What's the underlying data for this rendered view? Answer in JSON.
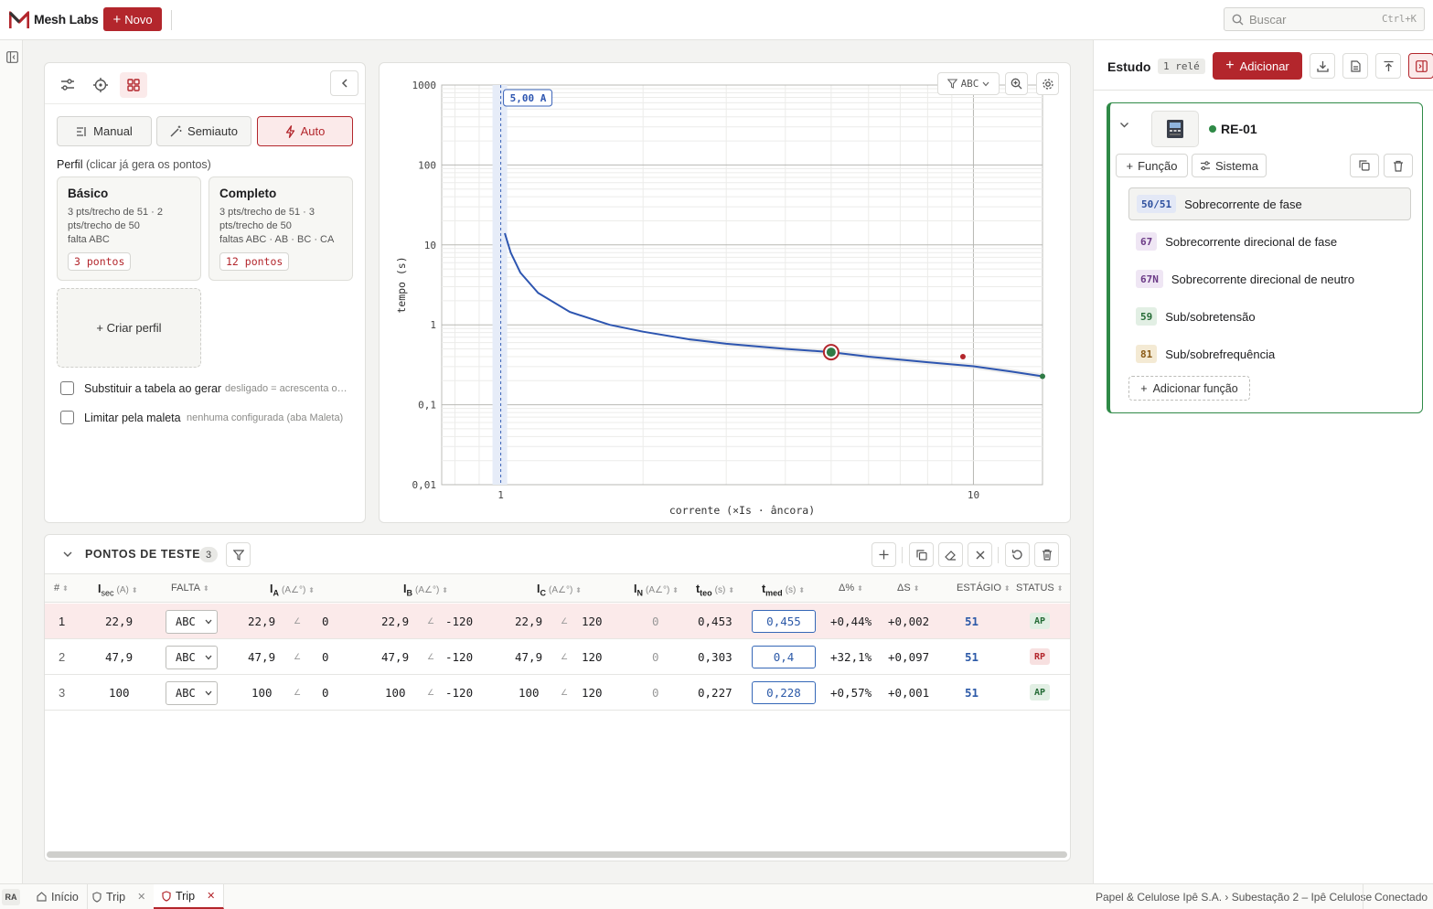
{
  "header": {
    "app_name": "Mesh Labs",
    "new_label": "Novo",
    "search_placeholder": "Buscar",
    "search_shortcut": "Ctrl+K",
    "brand_color": "#b3262c"
  },
  "left_panel": {
    "modes": [
      {
        "label": "Manual",
        "active": false
      },
      {
        "label": "Semiauto",
        "active": false
      },
      {
        "label": "Auto",
        "active": true
      }
    ],
    "profile_title": "Perfil",
    "profile_hint": "(clicar já gera os pontos)",
    "profiles": [
      {
        "name": "Básico",
        "line1": "3 pts/trecho de 51 · 2",
        "line2": "pts/trecho de 50",
        "line3": "falta ABC",
        "badge": "3 pontos"
      },
      {
        "name": "Completo",
        "line1": "3 pts/trecho de 51 · 3",
        "line2": "pts/trecho de 50",
        "line3": "faltas ABC · AB · BC · CA",
        "badge": "12 pontos"
      }
    ],
    "create_profile": "+ Criar perfil",
    "options": [
      {
        "label": "Substituir a tabela ao gerar",
        "hint": "desligado = acrescenta os ...",
        "checked": false
      },
      {
        "label": "Limitar pela maleta",
        "hint": "nenhuma configurada (aba Maleta)",
        "checked": false
      }
    ]
  },
  "chart_toolbar": {
    "fault_filter": "ABC"
  },
  "chart_data": {
    "type": "line",
    "xscale": "log",
    "yscale": "log",
    "xlim": [
      0.75,
      14
    ],
    "ylim": [
      0.01,
      1000
    ],
    "xlabel": "corrente (×Is · âncora)",
    "ylabel": "tempo (s)",
    "x_ticks": [
      "1",
      "10"
    ],
    "y_ticks": [
      "0,01",
      "0,1",
      "1",
      "10",
      "100",
      "1000"
    ],
    "marker_label": "5,00 A",
    "marker_x": 1.0,
    "grid": true,
    "curve": {
      "x": [
        1.02,
        1.05,
        1.1,
        1.2,
        1.4,
        1.7,
        2.0,
        2.5,
        3.0,
        4.0,
        5.0,
        6.0,
        8.0,
        10.0,
        12.0,
        14.0
      ],
      "y": [
        14.0,
        8.0,
        4.5,
        2.5,
        1.45,
        1.0,
        0.82,
        0.66,
        0.58,
        0.5,
        0.455,
        0.4,
        0.34,
        0.303,
        0.26,
        0.227
      ]
    },
    "points": [
      {
        "x": 5.0,
        "y": 0.455,
        "status": "AP",
        "selected": true
      },
      {
        "x": 9.5,
        "y": 0.4,
        "status": "RP"
      },
      {
        "x": 14.0,
        "y": 0.227,
        "status": "AP"
      }
    ],
    "curve_color": "#2d55b0"
  },
  "table": {
    "title": "PONTOS DE TESTE",
    "count": "3",
    "columns": {
      "num": "#",
      "isec": "I",
      "isec_sub": "sec",
      "isec_unit": "(A)",
      "falta": "FALTA",
      "ia": "I",
      "ia_sub": "A",
      "ia_unit": "(A∠°)",
      "ib": "I",
      "ib_sub": "B",
      "ib_unit": "(A∠°)",
      "ic": "I",
      "ic_sub": "C",
      "ic_unit": "(A∠°)",
      "in": "I",
      "in_sub": "N",
      "in_unit": "(A∠°)",
      "tteo": "t",
      "tteo_sub": "teo",
      "tteo_unit": "(s)",
      "tmed": "t",
      "tmed_sub": "med",
      "tmed_unit": "(s)",
      "dpct": "Δ%",
      "ds": "ΔS",
      "estagio": "ESTÁGIO",
      "status": "STATUS"
    },
    "angle_symbol": "∠",
    "rows": [
      {
        "num": "1",
        "isec": "22,9",
        "falta": "ABC",
        "ia": "22,9",
        "ia_ang": "0",
        "ib": "22,9",
        "ib_ang": "-120",
        "ic": "22,9",
        "ic_ang": "120",
        "in": "0",
        "tteo": "0,453",
        "tmed": "0,455",
        "dpct": "+0,44%",
        "ds": "+0,002",
        "estagio": "51",
        "status": "AP"
      },
      {
        "num": "2",
        "isec": "47,9",
        "falta": "ABC",
        "ia": "47,9",
        "ia_ang": "0",
        "ib": "47,9",
        "ib_ang": "-120",
        "ic": "47,9",
        "ic_ang": "120",
        "in": "0",
        "tteo": "0,303",
        "tmed": "0,4",
        "dpct": "+32,1%",
        "ds": "+0,097",
        "estagio": "51",
        "status": "RP"
      },
      {
        "num": "3",
        "isec": "100",
        "falta": "ABC",
        "ia": "100",
        "ia_ang": "0",
        "ib": "100",
        "ib_ang": "-120",
        "ic": "100",
        "ic_ang": "120",
        "in": "0",
        "tteo": "0,227",
        "tmed": "0,228",
        "dpct": "+0,57%",
        "ds": "+0,001",
        "estagio": "51",
        "status": "AP"
      }
    ]
  },
  "right_panel": {
    "title": "Estudo",
    "count_badge": "1 relé",
    "add_label": "Adicionar",
    "relay": {
      "name": "RE-01",
      "funcao_label": "Função",
      "sistema_label": "Sistema",
      "functions": [
        {
          "code": "50/51",
          "name": "Sobrecorrente de fase",
          "selected": true,
          "bg": "#e3e8f6",
          "fg": "#2d4f9e"
        },
        {
          "code": "67",
          "name": "Sobrecorrente direcional de fase",
          "bg": "#efe6f4",
          "fg": "#6b3a86"
        },
        {
          "code": "67N",
          "name": "Sobrecorrente direcional de neutro",
          "bg": "#efe6f4",
          "fg": "#6b3a86"
        },
        {
          "code": "59",
          "name": "Sub/sobretensão",
          "bg": "#e2efe4",
          "fg": "#256b36"
        },
        {
          "code": "81",
          "name": "Sub/sobrefrequência",
          "bg": "#f4ead4",
          "fg": "#8a5a16"
        }
      ],
      "add_function": "Adicionar função"
    }
  },
  "footer": {
    "user_initials": "RA",
    "tabs": [
      {
        "label": "Início",
        "closable": false
      },
      {
        "label": "Trip",
        "closable": true
      },
      {
        "label": "Trip",
        "closable": true,
        "active": true
      }
    ],
    "breadcrumb": "Papel & Celulose Ipê S.A. › Subestação 2 – Ipê Celulose",
    "status": "Conectado"
  }
}
